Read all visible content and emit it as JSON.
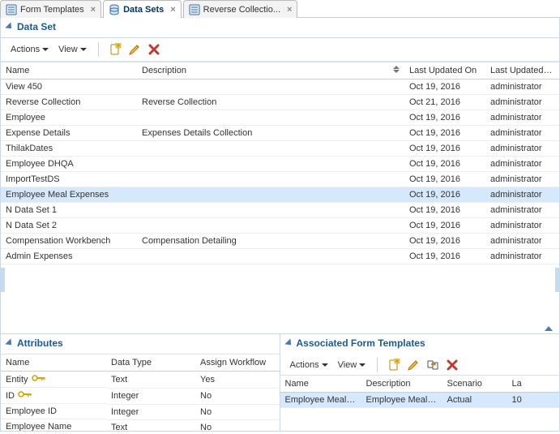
{
  "tabs": [
    {
      "label": "Form Templates",
      "active": false
    },
    {
      "label": "Data Sets",
      "active": true
    },
    {
      "label": "Reverse Collectio...",
      "active": false
    }
  ],
  "dataset_panel": {
    "title": "Data Set",
    "actions_label": "Actions",
    "view_label": "View",
    "columns": {
      "name": "Name",
      "description": "Description",
      "last_updated_on": "Last Updated On",
      "last_updated_by": "Last Updated By"
    },
    "rows": [
      {
        "name": "View 450",
        "description": "",
        "last_updated_on": "Oct 19, 2016",
        "last_updated_by": "administrator",
        "selected": false
      },
      {
        "name": "Reverse Collection",
        "description": "Reverse Collection",
        "last_updated_on": "Oct 21, 2016",
        "last_updated_by": "administrator",
        "selected": false
      },
      {
        "name": "Employee",
        "description": "",
        "last_updated_on": "Oct 19, 2016",
        "last_updated_by": "administrator",
        "selected": false
      },
      {
        "name": "Expense Details",
        "description": "Expenses Details Collection",
        "last_updated_on": "Oct 19, 2016",
        "last_updated_by": "administrator",
        "selected": false
      },
      {
        "name": "ThilakDates",
        "description": "",
        "last_updated_on": "Oct 19, 2016",
        "last_updated_by": "administrator",
        "selected": false
      },
      {
        "name": "Employee DHQA",
        "description": "",
        "last_updated_on": "Oct 19, 2016",
        "last_updated_by": "administrator",
        "selected": false
      },
      {
        "name": "ImportTestDS",
        "description": "",
        "last_updated_on": "Oct 19, 2016",
        "last_updated_by": "administrator",
        "selected": false
      },
      {
        "name": "Employee Meal Expenses",
        "description": "",
        "last_updated_on": "Oct 19, 2016",
        "last_updated_by": "administrator",
        "selected": true
      },
      {
        "name": "N Data Set 1",
        "description": "",
        "last_updated_on": "Oct 19, 2016",
        "last_updated_by": "administrator",
        "selected": false
      },
      {
        "name": "N Data Set 2",
        "description": "",
        "last_updated_on": "Oct 19, 2016",
        "last_updated_by": "administrator",
        "selected": false
      },
      {
        "name": "Compensation Workbench",
        "description": "Compensation Detailing",
        "last_updated_on": "Oct 19, 2016",
        "last_updated_by": "administrator",
        "selected": false
      },
      {
        "name": "Admin Expenses",
        "description": "",
        "last_updated_on": "Oct 19, 2016",
        "last_updated_by": "administrator",
        "selected": false
      }
    ]
  },
  "attributes_panel": {
    "title": "Attributes",
    "columns": {
      "name": "Name",
      "data_type": "Data Type",
      "assign_workflow": "Assign Workflow"
    },
    "rows": [
      {
        "name": "Entity",
        "key": true,
        "data_type": "Text",
        "assign_workflow": "Yes"
      },
      {
        "name": "ID",
        "key": true,
        "data_type": "Integer",
        "assign_workflow": "No"
      },
      {
        "name": "Employee ID",
        "key": false,
        "data_type": "Integer",
        "assign_workflow": "No"
      },
      {
        "name": "Employee Name",
        "key": false,
        "data_type": "Text",
        "assign_workflow": "No"
      }
    ]
  },
  "assoc_panel": {
    "title": "Associated Form Templates",
    "actions_label": "Actions",
    "view_label": "View",
    "columns": {
      "name": "Name",
      "description": "Description",
      "scenario": "Scenario",
      "last": "La"
    },
    "rows": [
      {
        "name": "Employee Meal Expen",
        "description": "Employee Meal Expen",
        "scenario": "Actual",
        "last": "10",
        "selected": true
      }
    ]
  }
}
